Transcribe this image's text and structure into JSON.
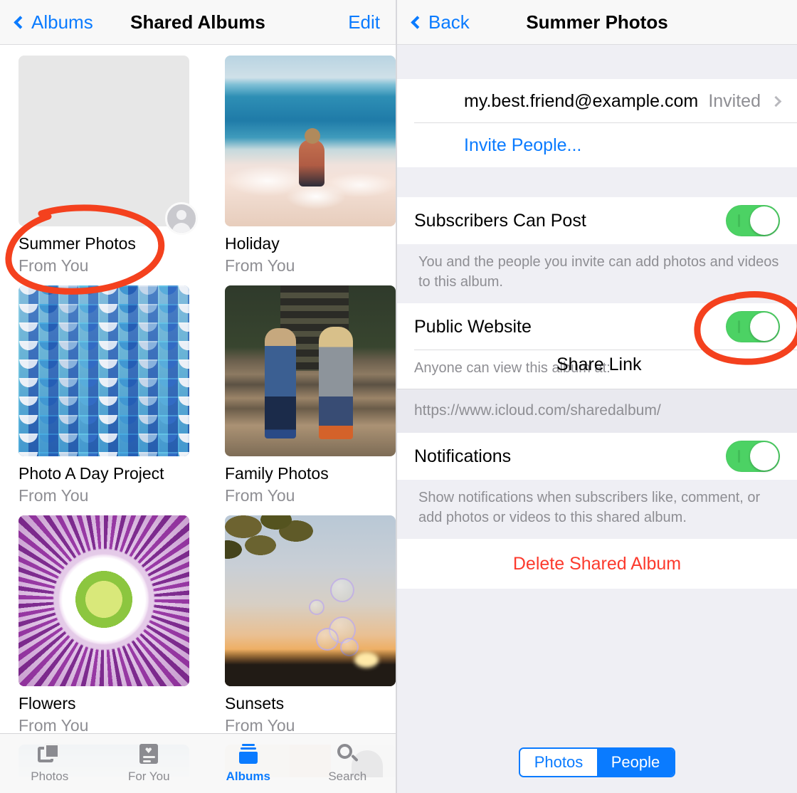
{
  "left": {
    "nav": {
      "back_label": "Albums",
      "title": "Shared Albums",
      "edit_label": "Edit"
    },
    "albums": [
      {
        "title": "Summer Photos",
        "subtitle": "From You",
        "art": "empty",
        "has_avatar": true
      },
      {
        "title": "Holiday",
        "subtitle": "From You",
        "art": "beach",
        "has_avatar": false
      },
      {
        "title": "Photo A Day Project",
        "subtitle": "From You",
        "art": "tiles",
        "has_avatar": false
      },
      {
        "title": "Family Photos",
        "subtitle": "From You",
        "art": "kids",
        "has_avatar": false
      },
      {
        "title": "Flowers",
        "subtitle": "From You",
        "art": "flower",
        "has_avatar": false
      },
      {
        "title": "Sunsets",
        "subtitle": "From You",
        "art": "sunset",
        "has_avatar": false
      }
    ],
    "tabs": [
      {
        "label": "Photos",
        "icon": "photos-icon",
        "active": false
      },
      {
        "label": "For You",
        "icon": "for-you-icon",
        "active": false
      },
      {
        "label": "Albums",
        "icon": "albums-icon",
        "active": true
      },
      {
        "label": "Search",
        "icon": "search-icon",
        "active": false
      }
    ]
  },
  "right": {
    "nav": {
      "back_label": "Back",
      "title": "Summer Photos"
    },
    "subscriber": {
      "email": "my.best.friend@example.com",
      "status": "Invited"
    },
    "invite_label": "Invite People...",
    "subscribers_can_post": {
      "label": "Subscribers Can Post",
      "toggle_on": true,
      "footnote": "You and the people you invite can add photos and videos to this album."
    },
    "public_website": {
      "label": "Public Website",
      "toggle_on": true,
      "hint": "Anyone can view this album at:",
      "share_link_label": "Share Link",
      "url": "https://www.icloud.com/sharedalbum/"
    },
    "notifications": {
      "label": "Notifications",
      "toggle_on": true,
      "footnote": "Show notifications when subscribers like, comment, or add photos or videos to this shared album."
    },
    "delete_label": "Delete Shared Album",
    "segmented": {
      "options": [
        "Photos",
        "People"
      ],
      "selected": "People"
    }
  },
  "colors": {
    "accent_blue": "#0a7bff",
    "toggle_green": "#4cd264",
    "destructive_red": "#fc3a2d",
    "annotation_red": "#f4411e",
    "secondary_text": "#8e8e93"
  },
  "annotations": [
    {
      "name": "highlight-summer-photos-album",
      "shape": "ellipse"
    },
    {
      "name": "highlight-public-website-toggle",
      "shape": "ellipse"
    }
  ]
}
